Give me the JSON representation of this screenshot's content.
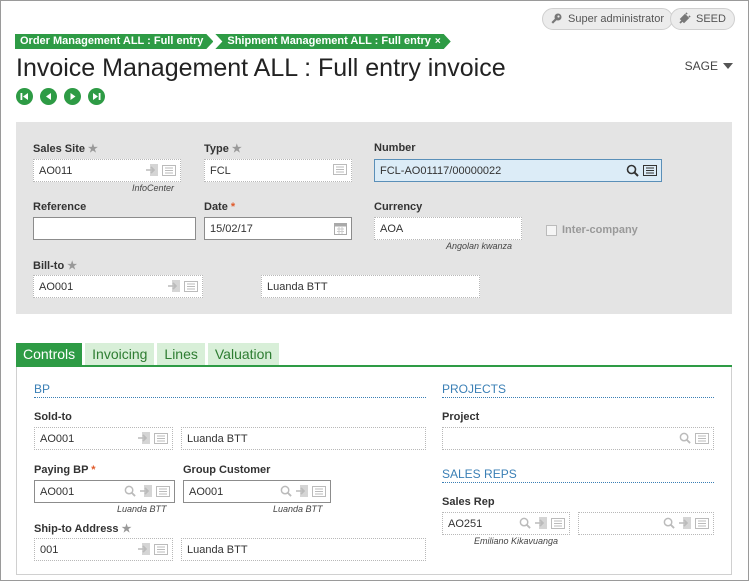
{
  "topbar": {
    "user_label": "Super administrator",
    "seed_label": "SEED"
  },
  "breadcrumbs": [
    {
      "label": "Order Management ALL : Full entry"
    },
    {
      "label": "Shipment Management ALL : Full entry",
      "close": "×"
    }
  ],
  "page_title": "Invoice Management ALL : Full entry invoice",
  "folder": "SAGE",
  "header": {
    "sales_site": {
      "label": "Sales Site",
      "value": "AO011",
      "sub": "InfoCenter"
    },
    "type": {
      "label": "Type",
      "value": "FCL"
    },
    "number": {
      "label": "Number",
      "value": "FCL-AO01117/00000022"
    },
    "reference": {
      "label": "Reference",
      "value": ""
    },
    "date": {
      "label": "Date",
      "value": "15/02/17"
    },
    "currency": {
      "label": "Currency",
      "value": "AOA",
      "sub": "Angolan kwanza"
    },
    "inter_company": {
      "label": "Inter-company",
      "checked": false
    },
    "bill_to": {
      "label": "Bill-to",
      "value": "AO001",
      "name": "Luanda BTT"
    }
  },
  "tabs": [
    {
      "label": "Controls",
      "active": true
    },
    {
      "label": "Invoicing",
      "active": false
    },
    {
      "label": "Lines",
      "active": false
    },
    {
      "label": "Valuation",
      "active": false
    }
  ],
  "controls": {
    "bp_title": "BP",
    "sold_to": {
      "label": "Sold-to",
      "value": "AO001",
      "name": "Luanda BTT"
    },
    "paying_bp": {
      "label": "Paying BP",
      "value": "AO001",
      "sub": "Luanda BTT"
    },
    "group_customer": {
      "label": "Group Customer",
      "value": "AO001",
      "sub": "Luanda BTT"
    },
    "ship_to": {
      "label": "Ship-to Address",
      "value": "001",
      "name": "Luanda BTT"
    },
    "projects_title": "PROJECTS",
    "project": {
      "label": "Project",
      "value": ""
    },
    "sales_reps_title": "SALES REPS",
    "sales_rep": {
      "label": "Sales Rep",
      "value": "AO251",
      "sub": "Emiliano Kikavuanga",
      "value2": ""
    }
  },
  "colors": {
    "accent": "#2e9b45",
    "section": "#3a7fb5",
    "required": "#e05a2a",
    "panel": "#e4e4e4"
  }
}
